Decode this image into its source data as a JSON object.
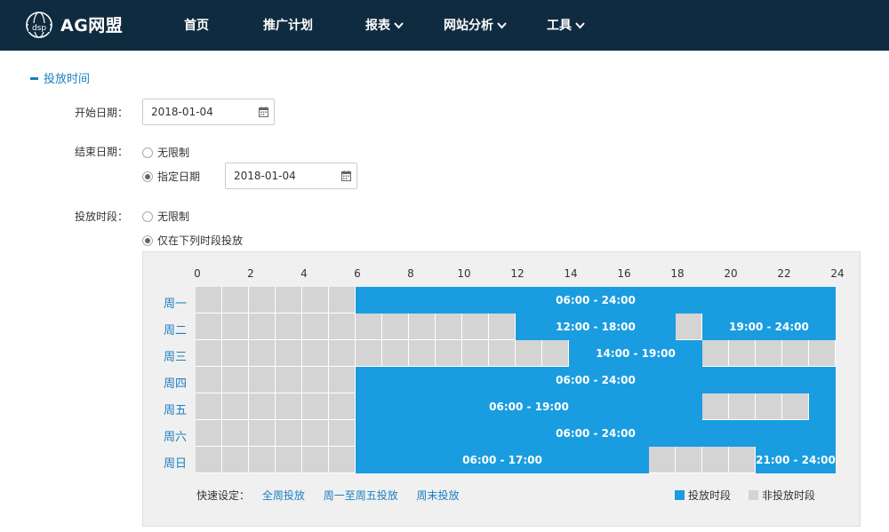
{
  "brand": {
    "name": "AG网盟",
    "logo_text": "dsp"
  },
  "nav": [
    {
      "label": "首页",
      "dropdown": false
    },
    {
      "label": "推广计划",
      "dropdown": false
    },
    {
      "label": "报表",
      "dropdown": true
    },
    {
      "label": "网站分析",
      "dropdown": true
    },
    {
      "label": "工具",
      "dropdown": true
    }
  ],
  "section": {
    "title": "投放时间"
  },
  "start_date": {
    "label": "开始日期：",
    "value": "2018-01-04"
  },
  "end_date": {
    "label": "结束日期：",
    "option_unlimited": "无限制",
    "option_specified": "指定日期",
    "selected": "specified",
    "value": "2018-01-04"
  },
  "schedule": {
    "label": "投放时段：",
    "option_unlimited": "无限制",
    "option_periods": "仅在下列时段投放",
    "selected": "periods",
    "hour_ticks": [
      "0",
      "2",
      "4",
      "6",
      "8",
      "10",
      "12",
      "14",
      "16",
      "18",
      "20",
      "22",
      "24"
    ],
    "days": [
      {
        "name": "周一",
        "on_hours": [
          6,
          7,
          8,
          9,
          10,
          11,
          12,
          13,
          14,
          15,
          16,
          17,
          18,
          19,
          20,
          21,
          22,
          23
        ],
        "ranges": [
          {
            "label": "06:00 - 24:00",
            "start": 6,
            "end": 24
          }
        ]
      },
      {
        "name": "周二",
        "on_hours": [
          12,
          13,
          14,
          15,
          16,
          17,
          19,
          20,
          21,
          22,
          23
        ],
        "ranges": [
          {
            "label": "12:00 - 18:00",
            "start": 12,
            "end": 18
          },
          {
            "label": "19:00 - 24:00",
            "start": 19,
            "end": 24
          }
        ]
      },
      {
        "name": "周三",
        "on_hours": [
          14,
          15,
          16,
          17,
          18
        ],
        "ranges": [
          {
            "label": "14:00 - 19:00",
            "start": 14,
            "end": 19
          }
        ]
      },
      {
        "name": "周四",
        "on_hours": [
          6,
          7,
          8,
          9,
          10,
          11,
          12,
          13,
          14,
          15,
          16,
          17,
          18,
          19,
          20,
          21,
          22,
          23
        ],
        "ranges": [
          {
            "label": "06:00 - 24:00",
            "start": 6,
            "end": 24
          }
        ]
      },
      {
        "name": "周五",
        "on_hours": [
          6,
          7,
          8,
          9,
          10,
          11,
          12,
          13,
          14,
          15,
          16,
          17,
          18,
          23
        ],
        "ranges": [
          {
            "label": "06:00 - 19:00",
            "start": 6,
            "end": 19
          }
        ]
      },
      {
        "name": "周六",
        "on_hours": [
          6,
          7,
          8,
          9,
          10,
          11,
          12,
          13,
          14,
          15,
          16,
          17,
          18,
          19,
          20,
          21,
          22,
          23
        ],
        "ranges": [
          {
            "label": "06:00 - 24:00",
            "start": 6,
            "end": 24
          }
        ]
      },
      {
        "name": "周日",
        "on_hours": [
          6,
          7,
          8,
          9,
          10,
          11,
          12,
          13,
          14,
          15,
          16,
          21,
          22,
          23
        ],
        "ranges": [
          {
            "label": "06:00 - 17:00",
            "start": 6,
            "end": 17
          },
          {
            "label": "21:00 - 24:00",
            "start": 21,
            "end": 24
          }
        ]
      }
    ],
    "quick_label": "快速设定：",
    "quick_options": [
      "全周投放",
      "周一至周五投放",
      "周末投放"
    ],
    "legend_on": "投放时段",
    "legend_off": "非投放时段"
  },
  "colors": {
    "topbar": "#0f2b40",
    "accent": "#1a7fc1",
    "on": "#1a9ce0",
    "off": "#d4d4d4"
  }
}
